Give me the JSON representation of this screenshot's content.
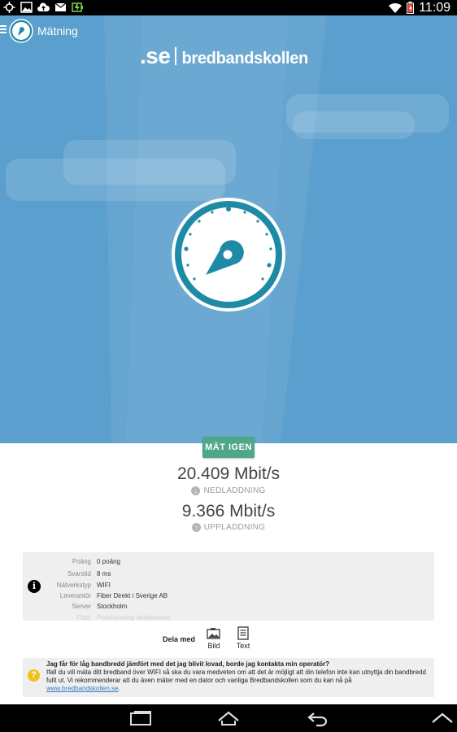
{
  "status_bar": {
    "time": "11:09",
    "left_icons": [
      "gps-icon",
      "image-icon",
      "cloud-upload-icon",
      "mail-icon",
      "battery-charging-icon"
    ],
    "right_icons": [
      "wifi-icon",
      "battery-icon"
    ]
  },
  "app_bar": {
    "title": "Mätning",
    "menu_icon": "hamburger-icon",
    "app_icon": "speedometer-icon"
  },
  "logo": {
    "prefix": ".se",
    "name": "bredbandskollen"
  },
  "gauge": {
    "icon": "speedometer-gauge-icon"
  },
  "measure_again_label": "MÄT IGEN",
  "results": {
    "download_value": "20.409 Mbit/s",
    "download_label": "NEDLADDNING",
    "upload_value": "9.366 Mbit/s",
    "upload_label": "UPPLADDNING"
  },
  "details": {
    "rows": [
      {
        "label": "Poäng",
        "value": "0 poäng"
      },
      {
        "label": "Svarstid",
        "value": "8 ms"
      },
      {
        "label": "Nätverkstyp",
        "value": "WIFI"
      },
      {
        "label": "Leverantör",
        "value": "Fiber Direkt i Sverige AB"
      },
      {
        "label": "Server",
        "value": "Stockholm"
      },
      {
        "label": "Plats",
        "value": "Positionering deaktiverad"
      }
    ]
  },
  "share": {
    "label": "Dela med",
    "image_label": "Bild",
    "text_label": "Text"
  },
  "faq": {
    "question": "Jag får för låg bandbredd jämfört med det jag blivit lovad, borde jag kontakta min operatör?",
    "answer": "Ifall du vill mäta ditt bredband över WIFI så ska du vara medveten om att det är möjligt att din telefon inte kan utnyttja din bandbredd fullt ut. Vi rekommenderar att du även mäter med en dator och vanliga Bredbandskollen som du kan nå på",
    "link": "www.bredbandskollen.se",
    "link_suffix": "."
  },
  "colors": {
    "hero_bg": "#5a9fcd",
    "button_green": "#4ea786",
    "gauge_ring": "#1f8aa5",
    "link_blue": "#3a7cc4",
    "faq_icon": "#f2c118"
  }
}
